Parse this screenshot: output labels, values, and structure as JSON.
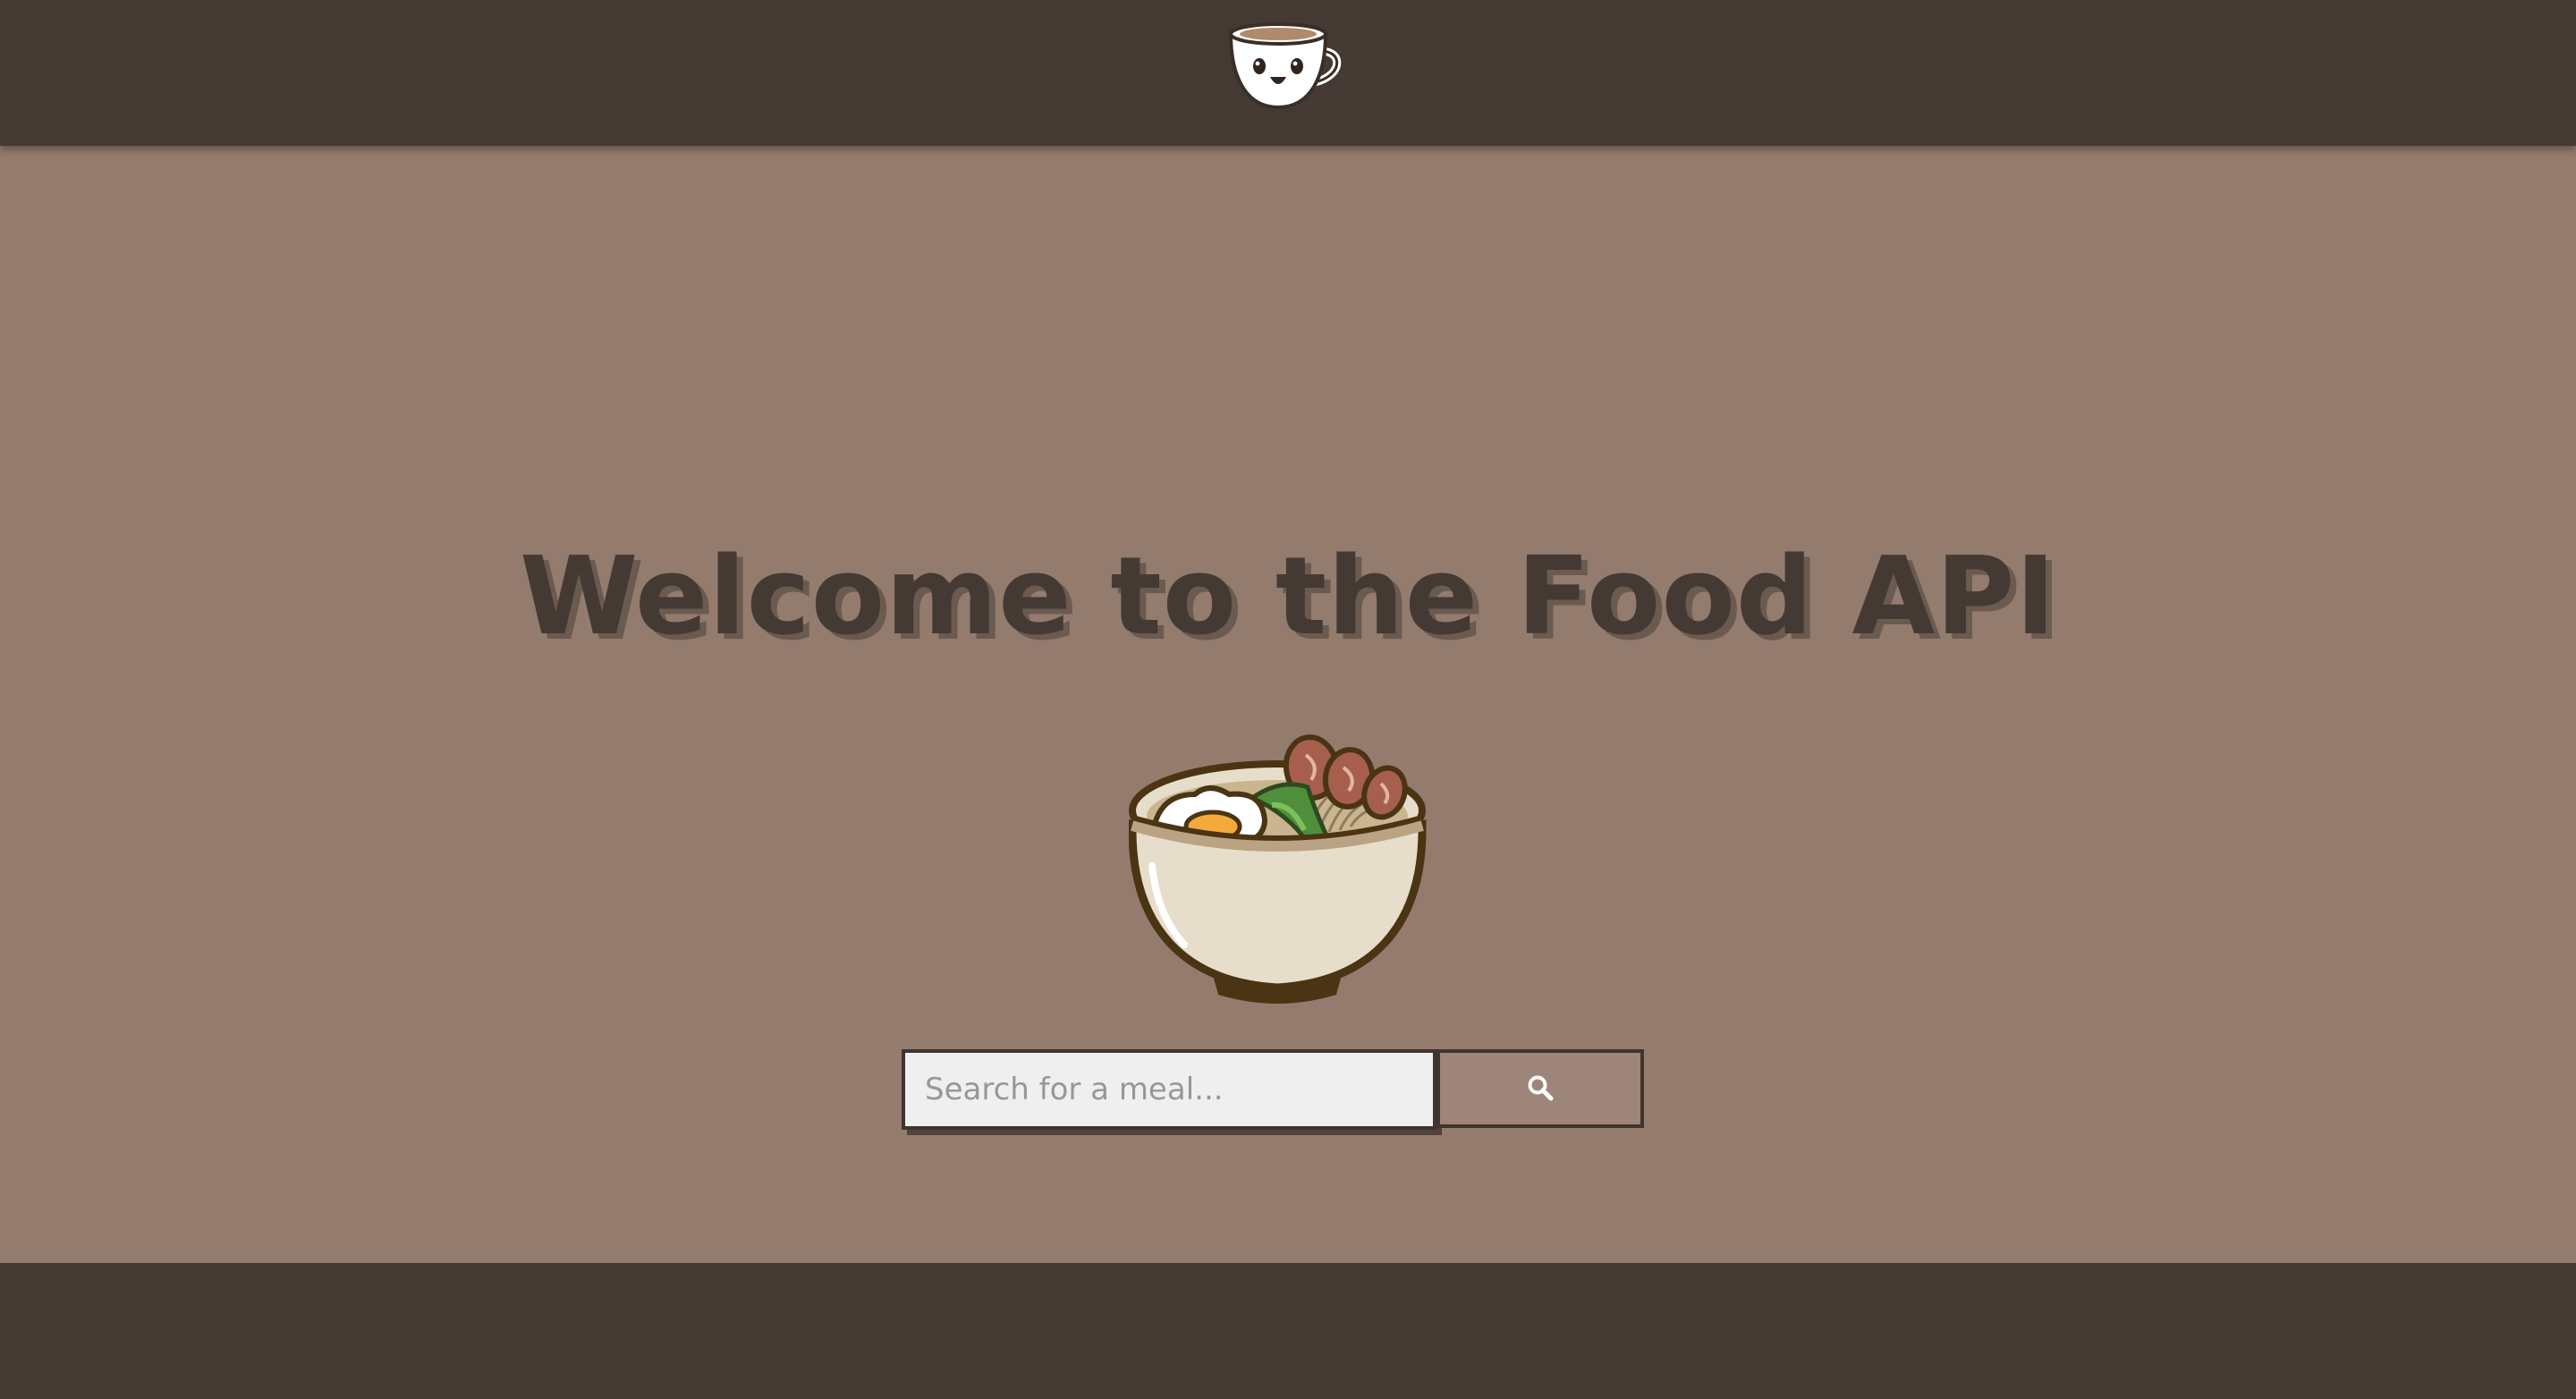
{
  "header": {
    "logo_icon": "smiling-coffee-cup-icon"
  },
  "main": {
    "title": "Welcome to the Food API",
    "illustration": "ramen-bowl-icon"
  },
  "search": {
    "placeholder": "Search for a meal...",
    "value": "",
    "button_icon": "search-icon"
  },
  "colors": {
    "header_bg": "#453a33",
    "page_bg": "#937b6e",
    "title_text": "#453a33",
    "button_bg": "#9e8579",
    "input_bg": "#f0efef"
  }
}
